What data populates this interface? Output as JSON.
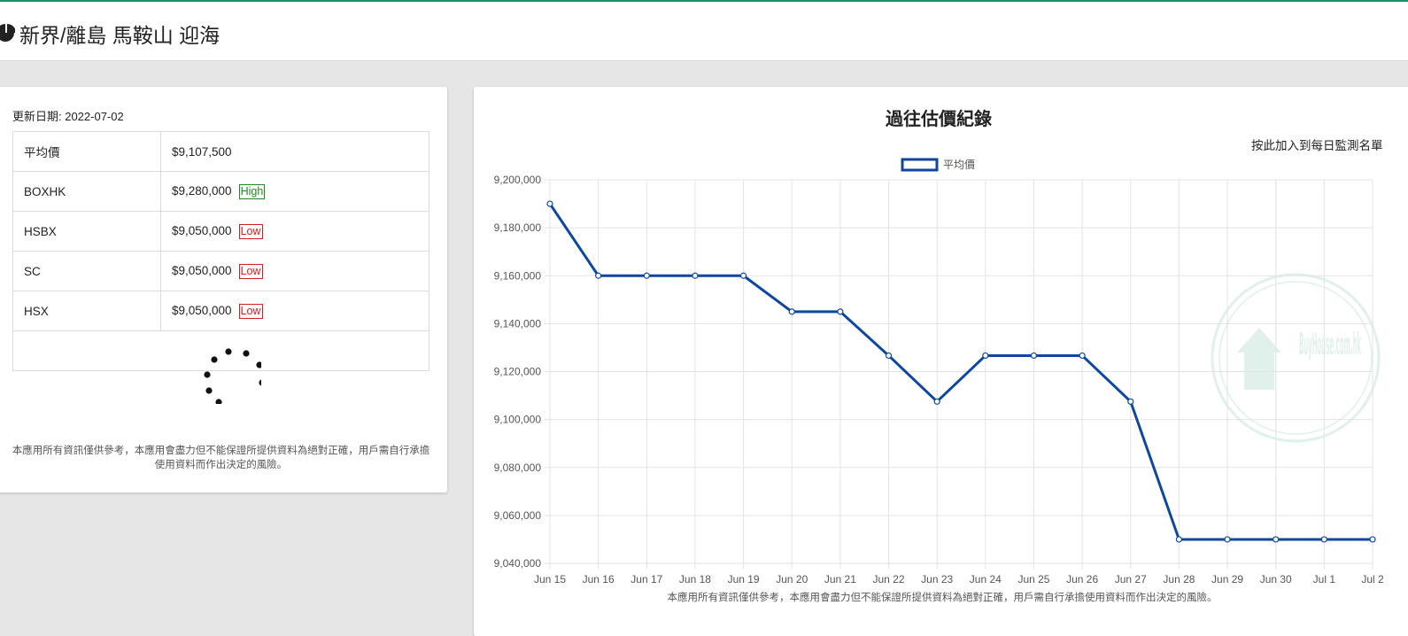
{
  "header": {
    "icon": "pie-chart-icon",
    "title": "新界/離島 馬鞍山 迎海"
  },
  "summary": {
    "updated_label": "更新日期: 2022-07-02",
    "rows": [
      {
        "label": "平均價",
        "value": "$9,107,500",
        "badge": ""
      },
      {
        "label": "BOXHK",
        "value": "$9,280,000",
        "badge": "High",
        "badge_type": "high"
      },
      {
        "label": "HSBX",
        "value": "$9,050,000",
        "badge": "Low",
        "badge_type": "low"
      },
      {
        "label": "SC",
        "value": "$9,050,000",
        "badge": "Low",
        "badge_type": "low"
      },
      {
        "label": "HSX",
        "value": "$9,050,000",
        "badge": "Low",
        "badge_type": "low"
      }
    ],
    "loading_icon": "loading-spinner-icon",
    "disclaimer": "本應用所有資訊僅供參考，本應用會盡力但不能保證所提供資料為絕對正確，用戶需自行承擔使用資料而作出決定的風險。"
  },
  "chart_panel": {
    "title": "過往估價紀錄",
    "watch_link": "按此加入到每日監測名單",
    "disclaimer": "本應用所有資訊僅供參考，本應用會盡力但不能保證所提供資料為絕對正確，用戶需自行承擔使用資料而作出決定的風險。",
    "watermark": "BuyHouse.com.hk"
  },
  "colors": {
    "line": "#0d47a1",
    "badge_high": "#1e8a1e",
    "badge_low": "#d62020",
    "top_accent": "#1a8f6c"
  },
  "chart_data": {
    "type": "line",
    "title": "過往估價紀錄",
    "legend": "top",
    "grid": true,
    "x": [
      "Jun 15",
      "Jun 16",
      "Jun 17",
      "Jun 18",
      "Jun 19",
      "Jun 20",
      "Jun 21",
      "Jun 22",
      "Jun 23",
      "Jun 24",
      "Jun 25",
      "Jun 26",
      "Jun 27",
      "Jun 28",
      "Jun 29",
      "Jun 30",
      "Jul 1",
      "Jul 2"
    ],
    "y_ticks": [
      "9,040,000",
      "9,060,000",
      "9,080,000",
      "9,100,000",
      "9,120,000",
      "9,140,000",
      "9,160,000",
      "9,180,000",
      "9,200,000"
    ],
    "ylim": [
      9040000,
      9200000
    ],
    "series": [
      {
        "name": "平均價",
        "values": [
          9190000,
          9160000,
          9160000,
          9160000,
          9160000,
          9145000,
          9145000,
          9126667,
          9107500,
          9126667,
          9126667,
          9126667,
          9107500,
          9050000,
          9050000,
          9050000,
          9050000,
          9050000
        ]
      }
    ]
  }
}
